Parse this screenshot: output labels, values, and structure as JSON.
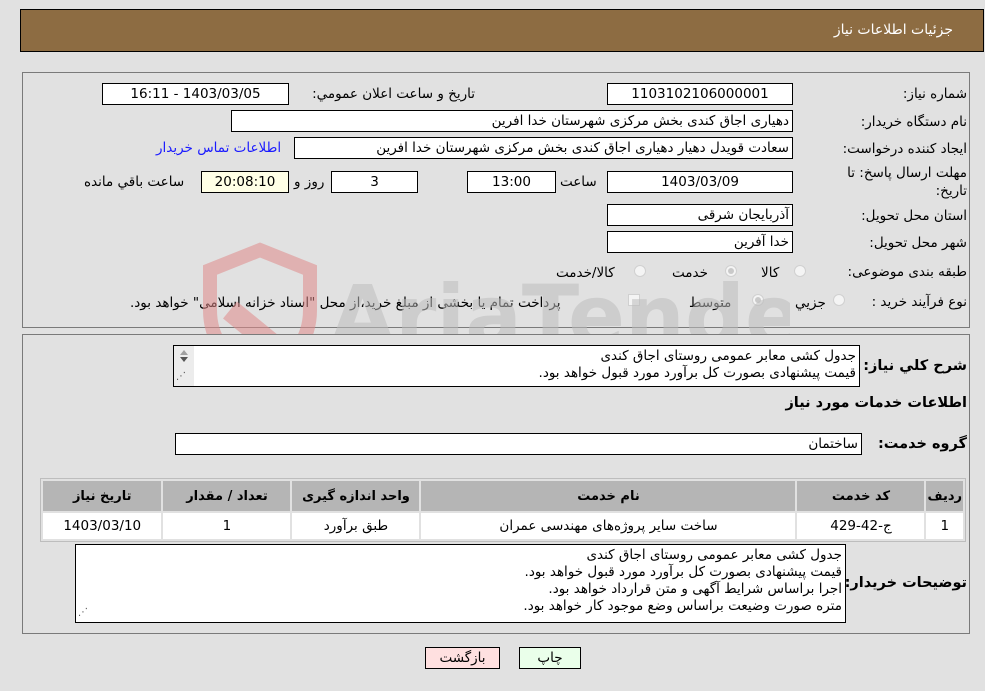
{
  "header": {
    "title": "جزئيات اطلاعات نياز"
  },
  "details": {
    "need_number_label": "شماره نياز:",
    "need_number": "1103102106000001",
    "announce_label": "تاريخ و ساعت اعلان عمومي:",
    "announce_value": "1403/03/05 - 16:11",
    "buyer_org_label": "نام دستگاه خريدار:",
    "buyer_org": "دهیاری اجاق کندی بخش مرکزی شهرستان خدا افرین",
    "creator_label": "ايجاد کننده درخواست:",
    "creator": "سعادت قویدل دهیار  دهیاری اجاق کندی بخش مرکزی شهرستان خدا افرین",
    "contact_link": "اطلاعات تماس خريدار",
    "deadline_label_line1": "مهلت ارسال پاسخ: تا",
    "deadline_label_line2": "تاريخ:",
    "deadline_date": "1403/03/09",
    "time_label": "ساعت",
    "deadline_time": "13:00",
    "days_value": "3",
    "days_label": "روز و",
    "remaining_time": "20:08:10",
    "remaining_label": "ساعت باقي مانده",
    "province_label": "استان محل تحويل:",
    "province": "آذربایجان شرقی",
    "city_label": "شهر محل تحويل:",
    "city": "خدا آفرین",
    "category_label": "طبقه بندی موضوعی:",
    "category_options": [
      {
        "label": "کالا",
        "selected": false
      },
      {
        "label": "خدمت",
        "selected": true
      },
      {
        "label": "کالا/خدمت",
        "selected": false
      }
    ],
    "purchase_type_label": "نوع فرآيند خريد :",
    "purchase_options": [
      {
        "label": "جزيي",
        "selected": false
      },
      {
        "label": "متوسط",
        "selected": true
      }
    ],
    "treasury_checkbox_label": "پرداخت تمام یا بخشی از مبلغ خرید،از محل \"اسناد خزانه اسلامی\" خواهد بود.",
    "treasury_checked": false
  },
  "description": {
    "label": "شرح کلي نياز:",
    "lines": [
      "جدول کشی معابر عمومی روستای اجاق کندی",
      "قیمت پیشنهادی بصورت کل برآورد مورد قبول خواهد بود."
    ]
  },
  "services": {
    "section_title": "اطلاعات خدمات مورد نياز",
    "group_label": "گروه خدمت:",
    "group_value": "ساختمان",
    "table": {
      "headers": [
        "رديف",
        "کد خدمت",
        "نام خدمت",
        "واحد اندازه گيری",
        "تعداد / مقدار",
        "تاريخ نياز"
      ],
      "rows": [
        [
          "1",
          "ج-42-429",
          "ساخت سایر پروژه‌های مهندسی عمران",
          "طبق برآورد",
          "1",
          "1403/03/10"
        ]
      ]
    }
  },
  "buyer_notes": {
    "label": "توضيحات خريدار:",
    "lines": [
      "جدول کشی معابر عمومی روستای اجاق کندی",
      "قیمت پیشنهادی بصورت کل برآورد مورد قبول خواهد بود.",
      "اجرا براساس شرایط آگهی و متن قرارداد خواهد بود.",
      "متره صورت وضیعت براساس وضع موجود کار خواهد بود."
    ]
  },
  "buttons": {
    "print": "چاپ",
    "back": "بازگشت"
  },
  "watermark": {
    "text": "AriaTender.neT"
  },
  "colors": {
    "header_bg": "#8d6c42",
    "print_bg": "#eaffea",
    "back_bg": "#ffe0e0",
    "link": "#1a1aff"
  }
}
